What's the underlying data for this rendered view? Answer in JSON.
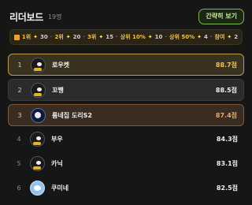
{
  "header": {
    "title": "리더보드",
    "count": "19명",
    "compact_button": "간략히 보기"
  },
  "rewards": [
    {
      "place": "1위",
      "amount": "30"
    },
    {
      "place": "2위",
      "amount": "20"
    },
    {
      "place": "3위",
      "amount": "15"
    },
    {
      "place": "상위 10%",
      "amount": "10"
    },
    {
      "place": "상위 50%",
      "amount": "4"
    },
    {
      "place": "참여",
      "amount": "2"
    }
  ],
  "leaderboard": [
    {
      "rank": "1",
      "name": "로우켓",
      "score": "88.7점",
      "avatar": "black-bird-icon"
    },
    {
      "rank": "2",
      "name": "꼬쨍",
      "score": "88.5점",
      "avatar": "black-bird-icon"
    },
    {
      "rank": "3",
      "name": "룸네집 도리S2",
      "score": "87.4점",
      "avatar": "moon-icon"
    },
    {
      "rank": "4",
      "name": "부우",
      "score": "84.3점",
      "avatar": "black-bird-icon"
    },
    {
      "rank": "5",
      "name": "카닉",
      "score": "83.1점",
      "avatar": "black-bird-icon"
    },
    {
      "rank": "6",
      "name": "쿠미네",
      "score": "82.5점",
      "avatar": "cloud-icon"
    }
  ]
}
